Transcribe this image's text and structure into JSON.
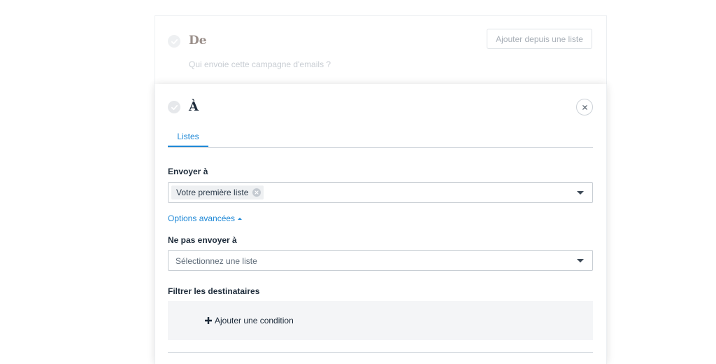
{
  "from_section": {
    "title": "De",
    "subtitle": "Qui envoie cette campagne d'emails ?",
    "add_from_list_label": "Ajouter depuis une liste"
  },
  "to_section": {
    "title": "À",
    "tabs": [
      {
        "label": "Listes",
        "active": true
      }
    ],
    "send_to": {
      "label": "Envoyer à",
      "selected": [
        "Votre première liste"
      ]
    },
    "advanced_options_label": "Options avancées",
    "exclude": {
      "label": "Ne pas envoyer à",
      "placeholder": "Sélectionnez une liste"
    },
    "filter": {
      "label": "Filtrer les destinataires",
      "add_condition_label": "Ajouter une condition"
    }
  },
  "colors": {
    "accent": "#1e88d6",
    "text_dark": "#1d2b3a",
    "muted": "#c8cdd3"
  },
  "icons": [
    "check-icon",
    "close-icon",
    "chevron-down-icon",
    "chevron-up-icon",
    "plus-icon",
    "remove-chip-icon"
  ]
}
